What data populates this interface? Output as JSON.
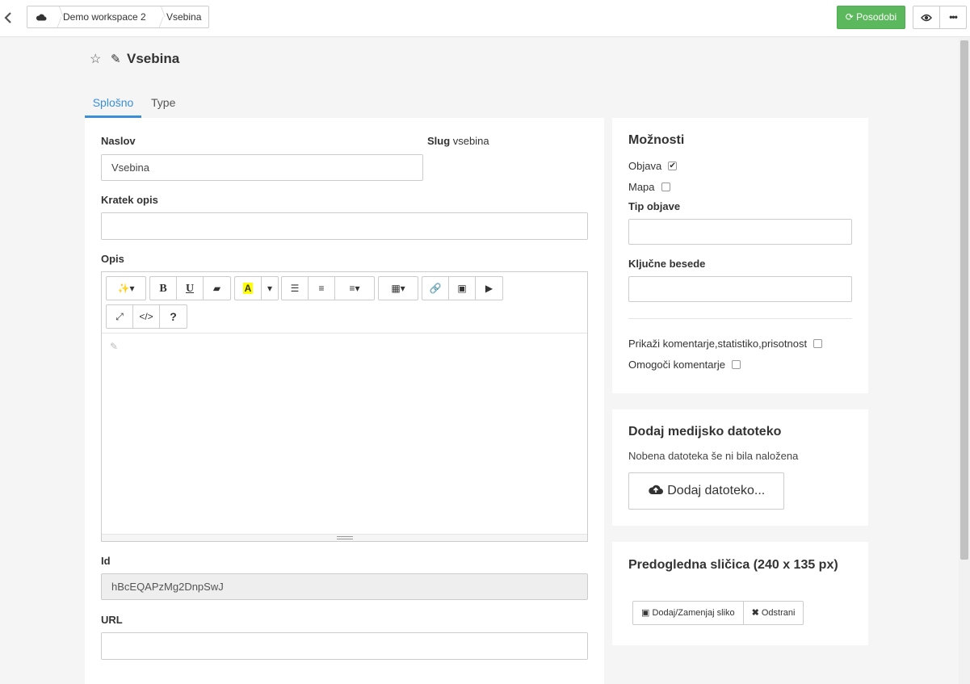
{
  "breadcrumb": {
    "workspace": "Demo workspace 2",
    "current": "Vsebina"
  },
  "toolbar": {
    "update_label": "Posodobi"
  },
  "page": {
    "title": "Vsebina"
  },
  "tabs": [
    {
      "label": "Splošno",
      "active": true
    },
    {
      "label": "Type",
      "active": false
    }
  ],
  "form": {
    "title_label": "Naslov",
    "title_value": "Vsebina",
    "slug_label": "Slug",
    "slug_value": "vsebina",
    "short_desc_label": "Kratek opis",
    "short_desc_value": "",
    "desc_label": "Opis",
    "id_label": "Id",
    "id_value": "hBcEQAPzMg2DnpSwJ",
    "url_label": "URL",
    "url_value": ""
  },
  "editor": {
    "icons": [
      "magic-icon",
      "bold-icon",
      "underline-icon",
      "eraser-icon",
      "highlight-icon",
      "list-ul-icon",
      "list-ol-icon",
      "align-icon",
      "table-icon",
      "link-icon",
      "image-icon",
      "video-icon",
      "fullscreen-icon",
      "code-icon",
      "help-icon"
    ]
  },
  "options": {
    "title": "Možnosti",
    "publish_label": "Objava",
    "publish_checked": true,
    "map_label": "Mapa",
    "map_checked": false,
    "type_label": "Tip objave",
    "type_value": "",
    "keywords_label": "Ključne besede",
    "keywords_value": "",
    "show_comments_label": "Prikaži komentarje,statistiko,prisotnost",
    "show_comments_checked": false,
    "enable_comments_label": "Omogoči komentarje",
    "enable_comments_checked": false
  },
  "media": {
    "title": "Dodaj medijsko datoteko",
    "empty_text": "Nobena datoteka še ni bila naložena",
    "upload_label": "Dodaj datoteko..."
  },
  "thumbnail": {
    "title": "Predogledna sličica (240 x 135 px)",
    "replace_label": "Dodaj/Zamenjaj sliko",
    "remove_label": "Odstrani"
  },
  "colors": {
    "accent": "#3b8ed8",
    "success": "#5cb85c"
  }
}
